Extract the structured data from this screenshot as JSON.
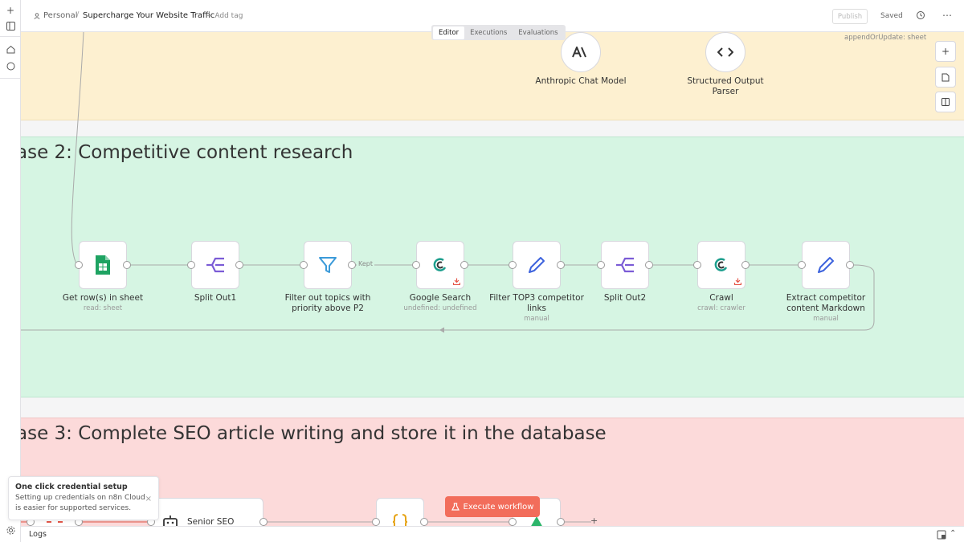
{
  "header": {
    "project": "Personal",
    "separator": "/",
    "workflow_title": "Supercharge Your Website Traffic",
    "add_tag": "+ Add tag",
    "publish_label": "Publish",
    "saved_label": "Saved",
    "more_label": "⋯"
  },
  "tabs": [
    {
      "label": "Editor",
      "active": true
    },
    {
      "label": "Executions",
      "active": false
    },
    {
      "label": "Evaluations",
      "active": false
    }
  ],
  "phase1": {
    "append_note": "appendOrUpdate: sheet",
    "nodes": [
      {
        "label": "Anthropic Chat Model",
        "icon": "anthropic-icon"
      },
      {
        "label": "Structured Output Parser",
        "icon": "code-brackets-icon"
      }
    ]
  },
  "phase2": {
    "title": "ase 2: Competitive content research",
    "kept_label": "Kept",
    "nodes": [
      {
        "label": "Get row(s) in sheet",
        "sub": "read: sheet",
        "icon": "google-sheets-icon"
      },
      {
        "label": "Split Out1",
        "sub": "",
        "icon": "split-out-icon"
      },
      {
        "label": "Filter out topics with priority above P2",
        "sub": "",
        "icon": "filter-icon"
      },
      {
        "label": "Google Search",
        "sub": "undefined: undefined",
        "icon": "serp-icon"
      },
      {
        "label": "Filter TOP3 competitor links",
        "sub": "manual",
        "icon": "pencil-icon"
      },
      {
        "label": "Split Out2",
        "sub": "",
        "icon": "split-out-icon"
      },
      {
        "label": "Crawl",
        "sub": "crawl: crawler",
        "icon": "serp-icon"
      },
      {
        "label": "Extract competitor content Markdown",
        "sub": "manual",
        "icon": "pencil-icon"
      }
    ]
  },
  "phase3": {
    "title": "ase 3: Complete SEO article writing and store it in the database",
    "node_label": "Senior SEO"
  },
  "execute_label": "Execute workflow",
  "toast": {
    "title": "One click credential setup",
    "body": "Setting up credentials on n8n Cloud is easier for supported services.",
    "close": "×"
  },
  "logs_label": "Logs",
  "colors": {
    "accent": "#f26d5b",
    "phase1_bg": "#fdf0d0",
    "phase2_bg": "#d6f5e3",
    "phase3_bg": "#fcdada",
    "icon_purple": "#7b5cd6",
    "icon_blue": "#3d63dd"
  }
}
